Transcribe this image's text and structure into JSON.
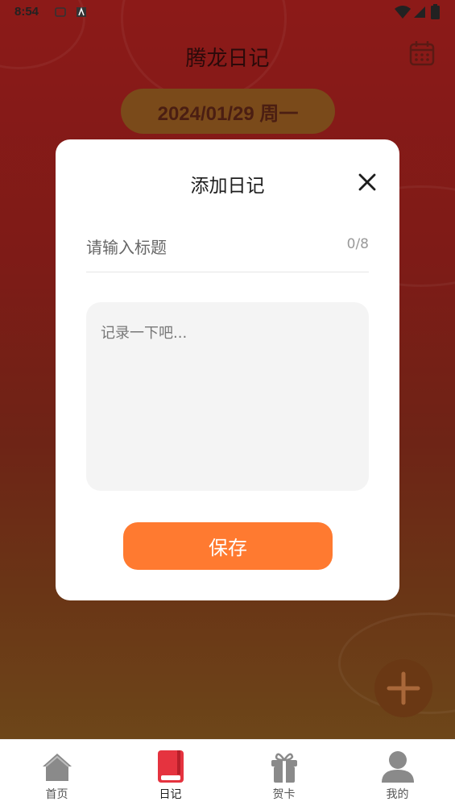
{
  "status_bar": {
    "time": "8:54"
  },
  "header": {
    "title": "腾龙日记",
    "calendar_icon": "calendar-icon"
  },
  "date_pill": {
    "text": "2024/01/29 周一"
  },
  "dialog": {
    "title": "添加日记",
    "title_input": {
      "placeholder": "请输入标题",
      "counter": "0/8"
    },
    "content_input": {
      "placeholder": "记录一下吧..."
    },
    "save_label": "保存"
  },
  "tabs": [
    {
      "label": "首页",
      "icon": "home-icon",
      "active": false
    },
    {
      "label": "日记",
      "icon": "diary-book-icon",
      "active": true
    },
    {
      "label": "贺卡",
      "icon": "gift-icon",
      "active": false
    },
    {
      "label": "我的",
      "icon": "user-icon",
      "active": false
    }
  ],
  "colors": {
    "accent": "#ff7a30",
    "active_tab": "#e5333f",
    "inactive_tab": "#8a8a8a",
    "background_red": "#8c1a18"
  }
}
